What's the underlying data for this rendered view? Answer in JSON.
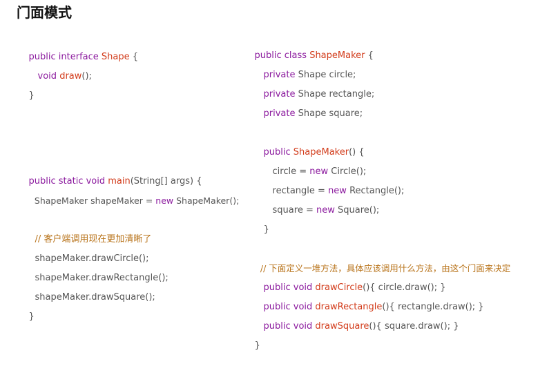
{
  "title": "门面模式",
  "colors": {
    "keyword": "#8b1a9e",
    "function": "#d23b1a",
    "comment": "#b8731a",
    "text": "#555555",
    "heading": "#111111"
  },
  "left": {
    "interface_block": {
      "l1": {
        "kw": "public interface ",
        "fn": "Shape",
        "tx": " {"
      },
      "l2": {
        "kw": "void ",
        "fn": "draw",
        "tx": "();"
      },
      "l3": {
        "tx": "}"
      }
    },
    "main_block": {
      "l1": {
        "kw": "public static void ",
        "fn": "main",
        "tx": "(String[] args) {"
      },
      "l2": {
        "tx1": "ShapeMaker shapeMaker = ",
        "kw": "new",
        "tx2": " ShapeMaker();"
      },
      "l3": {
        "cm": "// 客户端调用现在更加清晰了"
      },
      "l4": {
        "tx": "shapeMaker.drawCircle();"
      },
      "l5": {
        "tx": "shapeMaker.drawRectangle();"
      },
      "l6": {
        "tx": "shapeMaker.drawSquare();"
      },
      "l7": {
        "tx": "}"
      }
    }
  },
  "right": {
    "l1": {
      "kw": "public class ",
      "fn": "ShapeMaker",
      "tx": " {"
    },
    "l2": {
      "kw": "private",
      "tx": " Shape circle;"
    },
    "l3": {
      "kw": "private",
      "tx": " Shape rectangle;"
    },
    "l4": {
      "kw": "private",
      "tx": " Shape square;"
    },
    "l5": {
      "kw": "public ",
      "fn": "ShapeMaker",
      "tx": "() {"
    },
    "l6": {
      "tx1": "circle = ",
      "kw": "new",
      "tx2": " Circle();"
    },
    "l7": {
      "tx1": "rectangle = ",
      "kw": "new",
      "tx2": " Rectangle();"
    },
    "l8": {
      "tx1": "square = ",
      "kw": "new",
      "tx2": " Square();"
    },
    "l9": {
      "tx": "}"
    },
    "l10": {
      "cm": "// 下面定义一堆方法，具体应该调用什么方法，由这个门面来决定"
    },
    "l11": {
      "kw": "public void ",
      "fn": "drawCircle",
      "tx": "(){ circle.draw(); }"
    },
    "l12": {
      "kw": "public void ",
      "fn": "drawRectangle",
      "tx": "(){ rectangle.draw(); }"
    },
    "l13": {
      "kw": "public void ",
      "fn": "drawSquare",
      "tx": "(){ square.draw(); }"
    },
    "l14": {
      "tx": "}"
    }
  }
}
